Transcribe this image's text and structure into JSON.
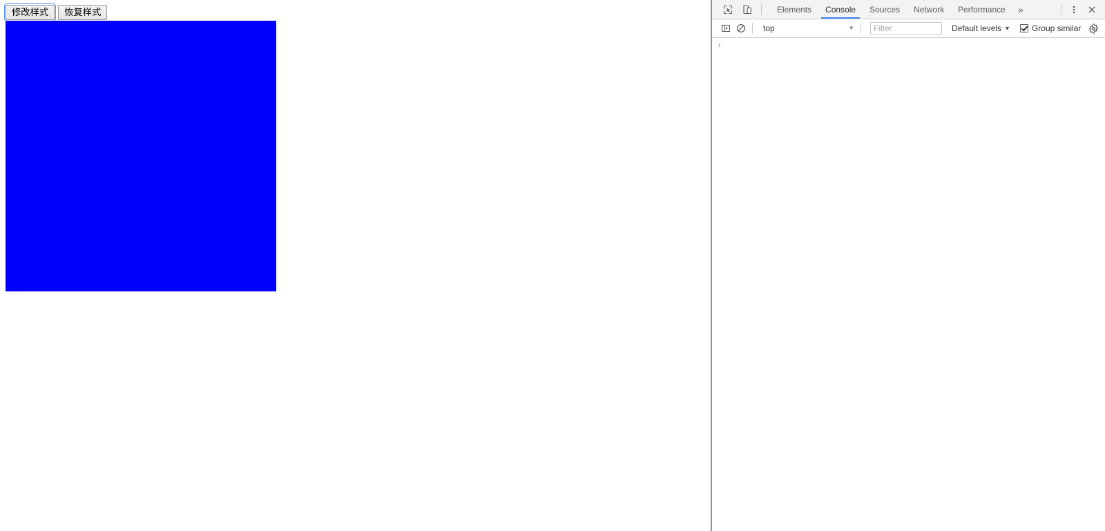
{
  "page": {
    "buttons": [
      {
        "label": "修改样式",
        "name": "modify-style-button",
        "focused": true
      },
      {
        "label": "恢复样式",
        "name": "restore-style-button",
        "focused": false
      }
    ],
    "demo_box": {
      "color": "#0000FF",
      "width": "392",
      "height": "392"
    }
  },
  "devtools": {
    "toolbar_icons": [
      {
        "name": "inspect-element-icon",
        "title": "Inspect element"
      },
      {
        "name": "device-toolbar-icon",
        "title": "Toggle device toolbar"
      }
    ],
    "tabs": [
      {
        "label": "Elements",
        "active": false
      },
      {
        "label": "Console",
        "active": true
      },
      {
        "label": "Sources",
        "active": false
      },
      {
        "label": "Network",
        "active": false
      },
      {
        "label": "Performance",
        "active": false
      }
    ],
    "overflow_label": "»",
    "more_options_label": "⋮",
    "close_label": "✕",
    "console_toolbar": {
      "sidebar_toggle_name": "console-sidebar-icon",
      "clear_console_name": "clear-console-icon",
      "context_value": "top",
      "context_arrow": "▼",
      "filter_placeholder": "Filter",
      "filter_value": "",
      "levels_label": "Default levels",
      "levels_arrow": "▼",
      "group_similar_label": "Group similar",
      "group_similar_checked": true,
      "settings_name": "settings-gear-icon"
    },
    "console": {
      "prompt_chevron": "›",
      "prompt_value": "",
      "messages": []
    }
  },
  "colors": {
    "accent": "#4285F4",
    "demo_blue": "#0000FF",
    "tabbar_bg": "#F3F3F3",
    "border": "#CDCDCD"
  }
}
